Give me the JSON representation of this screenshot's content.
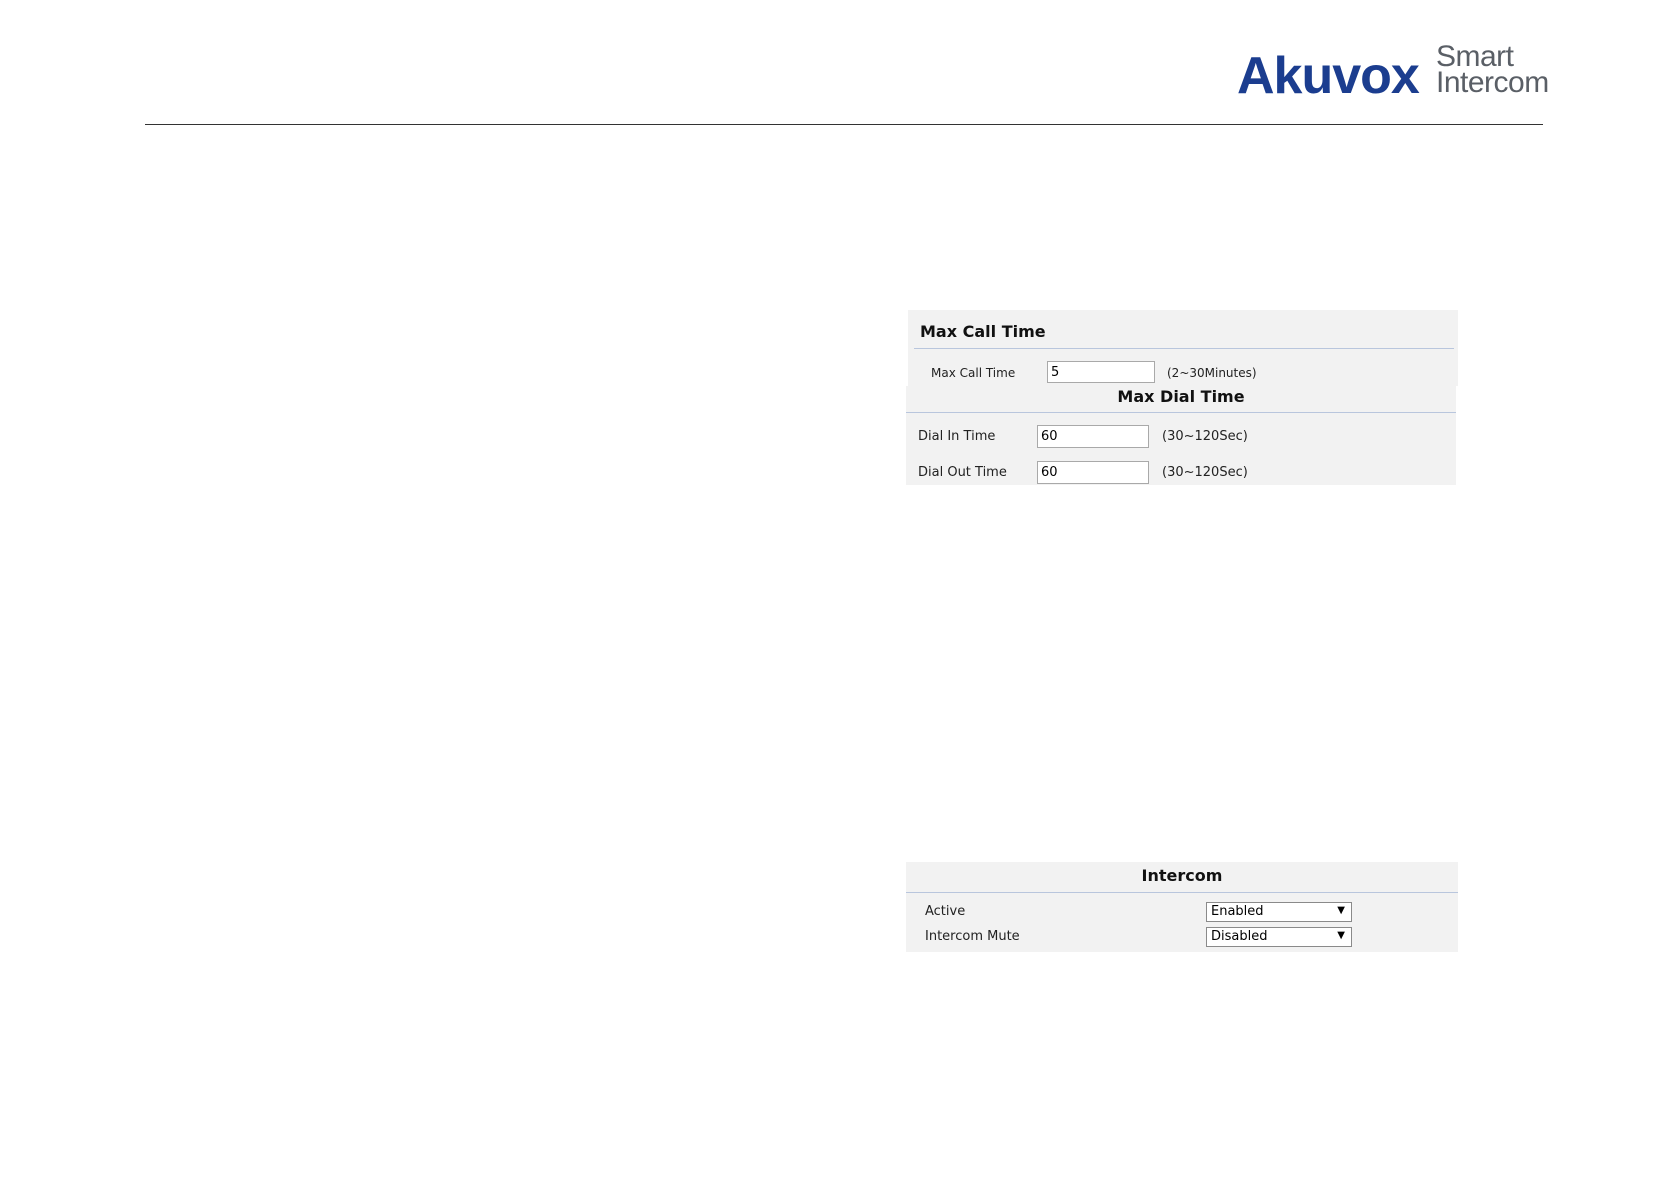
{
  "brand": {
    "name": "Akuvox",
    "tagline_line1": "Smart",
    "tagline_line2": "Intercom"
  },
  "max_call_time": {
    "title": "Max Call Time",
    "field_label": "Max Call Time",
    "value": "5",
    "range": "(2~30Minutes)"
  },
  "max_dial_time": {
    "title": "Max Dial Time",
    "dial_in_label": "Dial In Time",
    "dial_in_value": "60",
    "dial_in_range": "(30~120Sec)",
    "dial_out_label": "Dial Out Time",
    "dial_out_value": "60",
    "dial_out_range": "(30~120Sec)"
  },
  "intercom": {
    "title": "Intercom",
    "active_label": "Active",
    "active_value": "Enabled",
    "mute_label": "Intercom Mute",
    "mute_value": "Disabled"
  }
}
